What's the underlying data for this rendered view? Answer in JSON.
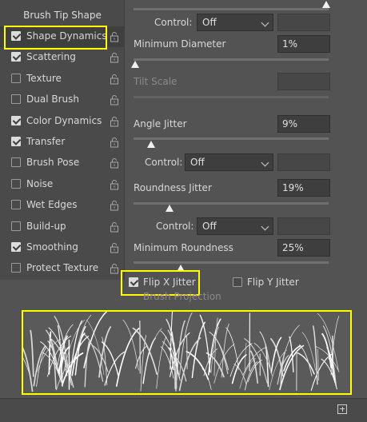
{
  "brush_settings": {
    "sidebar": {
      "title": "Brush Tip Shape",
      "items": [
        {
          "label": "Shape Dynamics",
          "checked": true,
          "selected": true
        },
        {
          "label": "Scattering",
          "checked": true
        },
        {
          "label": "Texture",
          "checked": false
        },
        {
          "label": "Dual Brush",
          "checked": false
        },
        {
          "label": "Color Dynamics",
          "checked": true
        },
        {
          "label": "Transfer",
          "checked": true
        },
        {
          "label": "Brush Pose",
          "checked": false
        },
        {
          "label": "Noise",
          "checked": false
        },
        {
          "label": "Wet Edges",
          "checked": false
        },
        {
          "label": "Build-up",
          "checked": false
        },
        {
          "label": "Smoothing",
          "checked": true
        },
        {
          "label": "Protect Texture",
          "checked": false
        }
      ]
    },
    "size_control": {
      "label": "Control:",
      "value": "Off"
    },
    "minimum_diameter": {
      "label": "Minimum Diameter",
      "value": "1%"
    },
    "tilt_scale": {
      "label": "Tilt Scale",
      "value": ""
    },
    "angle_jitter": {
      "label": "Angle Jitter",
      "value": "9%"
    },
    "angle_control": {
      "label": "Control:",
      "value": "Off"
    },
    "roundness_jitter": {
      "label": "Roundness Jitter",
      "value": "19%"
    },
    "roundness_control": {
      "label": "Control:",
      "value": "Off"
    },
    "minimum_roundness": {
      "label": "Minimum Roundness",
      "value": "25%"
    },
    "flip_x": {
      "label": "Flip X Jitter",
      "checked": true
    },
    "flip_y": {
      "label": "Flip Y Jitter",
      "checked": false
    },
    "brush_projection": {
      "label": "Brush Projection",
      "checked": false
    },
    "colors": {
      "panel": "#535353",
      "highlight": "#ffff00"
    }
  }
}
